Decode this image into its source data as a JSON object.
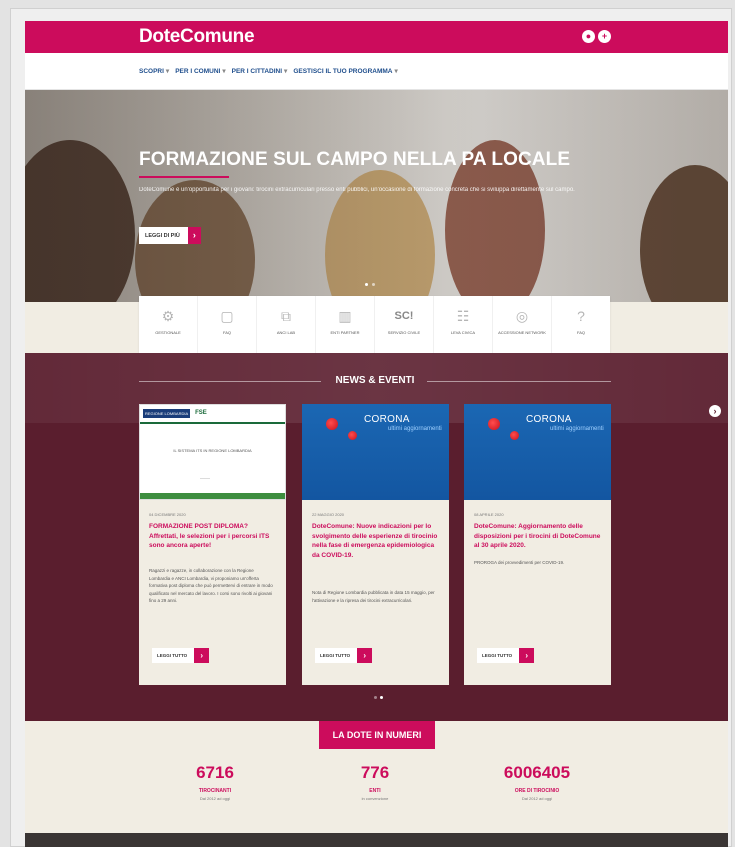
{
  "header": {
    "logo": "DoteComune",
    "icons": [
      "user-icon",
      "plus-icon"
    ]
  },
  "nav": {
    "items": [
      {
        "label": "SCOPRI"
      },
      {
        "label": "PER I COMUNI"
      },
      {
        "label": "PER I CITTADINI"
      },
      {
        "label": "GESTISCI IL TUO PROGRAMMA"
      }
    ]
  },
  "hero": {
    "title": "FORMAZIONE SUL CAMPO NELLA PA LOCALE",
    "subtitle": "DoteComune è un'opportunità per i giovani: tirocini extracurriculari presso enti pubblici, un'occasione di formazione concreta che si sviluppa direttamente sul campo.",
    "button_label": "LEGGI DI PIÙ"
  },
  "services": [
    {
      "label": "GESTIONALE",
      "icon": "gear-icon"
    },
    {
      "label": "FAQ",
      "icon": "chat-icon"
    },
    {
      "label": "ANCI LAB",
      "icon": "network-icon"
    },
    {
      "label": "ENTI PARTNER",
      "icon": "building-icon"
    },
    {
      "label": "SERVIZIO CIVILE",
      "icon": "sc-icon"
    },
    {
      "label": "LEVA CIVICA",
      "icon": "people-icon"
    },
    {
      "label": "ACCESSIONE NETWORK",
      "icon": "globe-icon"
    },
    {
      "label": "FAQ",
      "icon": "question-icon"
    }
  ],
  "news": {
    "section_title": "NEWS & EVENTI",
    "cards": [
      {
        "date": "04 DICEMBRE 2020",
        "title": "FORMAZIONE POST DIPLOMA? Affrettati, le selezioni per i percorsi ITS sono ancora aperte!",
        "text": "Ragazzi e ragazze, in collaborazione con la Regione Lombardia e ANCI Lombardia, vi proponiamo un'offerta formativa post diploma che può permettervi di entrare in modo qualificato nel mercato del lavoro. I corsi sono rivolti ai giovani fino a 29 anni.",
        "button_label": "LEGGI TUTTO",
        "image": {
          "logo_left": "REGIONE LOMBARDIA",
          "logo_right": "FSE",
          "caption": "IL SISTEMA ITS IN REGIONE LOMBARDIA"
        }
      },
      {
        "date": "22 MAGGIO 2020",
        "title": "DoteComune: Nuove indicazioni per lo svolgimento delle esperienze di tirocinio nella fase di emergenza epidemiologica da COVID-19.",
        "text": "Nota di Regione Lombardia pubblicata in data 15 maggio, per l'attivazione e la ripresa dei tirocini extracurricolari.",
        "button_label": "LEGGI TUTTO",
        "image": {
          "brand": "CORONA",
          "tagline": "ultimi aggiornamenti"
        }
      },
      {
        "date": "08 APRILE 2020",
        "title": "DoteComune: Aggiornamento delle disposizioni per i tirocini di DoteComune al 30 aprile 2020.",
        "text": "PROROGA dei provvedimenti per COVID-19.",
        "button_label": "LEGGI TUTTO",
        "image": {
          "brand": "CORONA",
          "tagline": "ultimi aggiornamenti"
        }
      }
    ]
  },
  "stats": {
    "title": "LA DOTE IN NUMERI",
    "items": [
      {
        "value": "6716",
        "label": "TIROCINANTI",
        "sub": "Dal 2012 ad oggi"
      },
      {
        "value": "776",
        "label": "ENTI",
        "sub": "in convenzione"
      },
      {
        "value": "6006405",
        "label": "ORE DI TIROCINIO",
        "sub": "Dal 2012 ad oggi"
      }
    ]
  },
  "colors": {
    "brand": "#cc0c5c",
    "news_bg": "#5a1e2e",
    "nav_text": "#1f4e8c",
    "page_bg": "#f1ede3"
  }
}
